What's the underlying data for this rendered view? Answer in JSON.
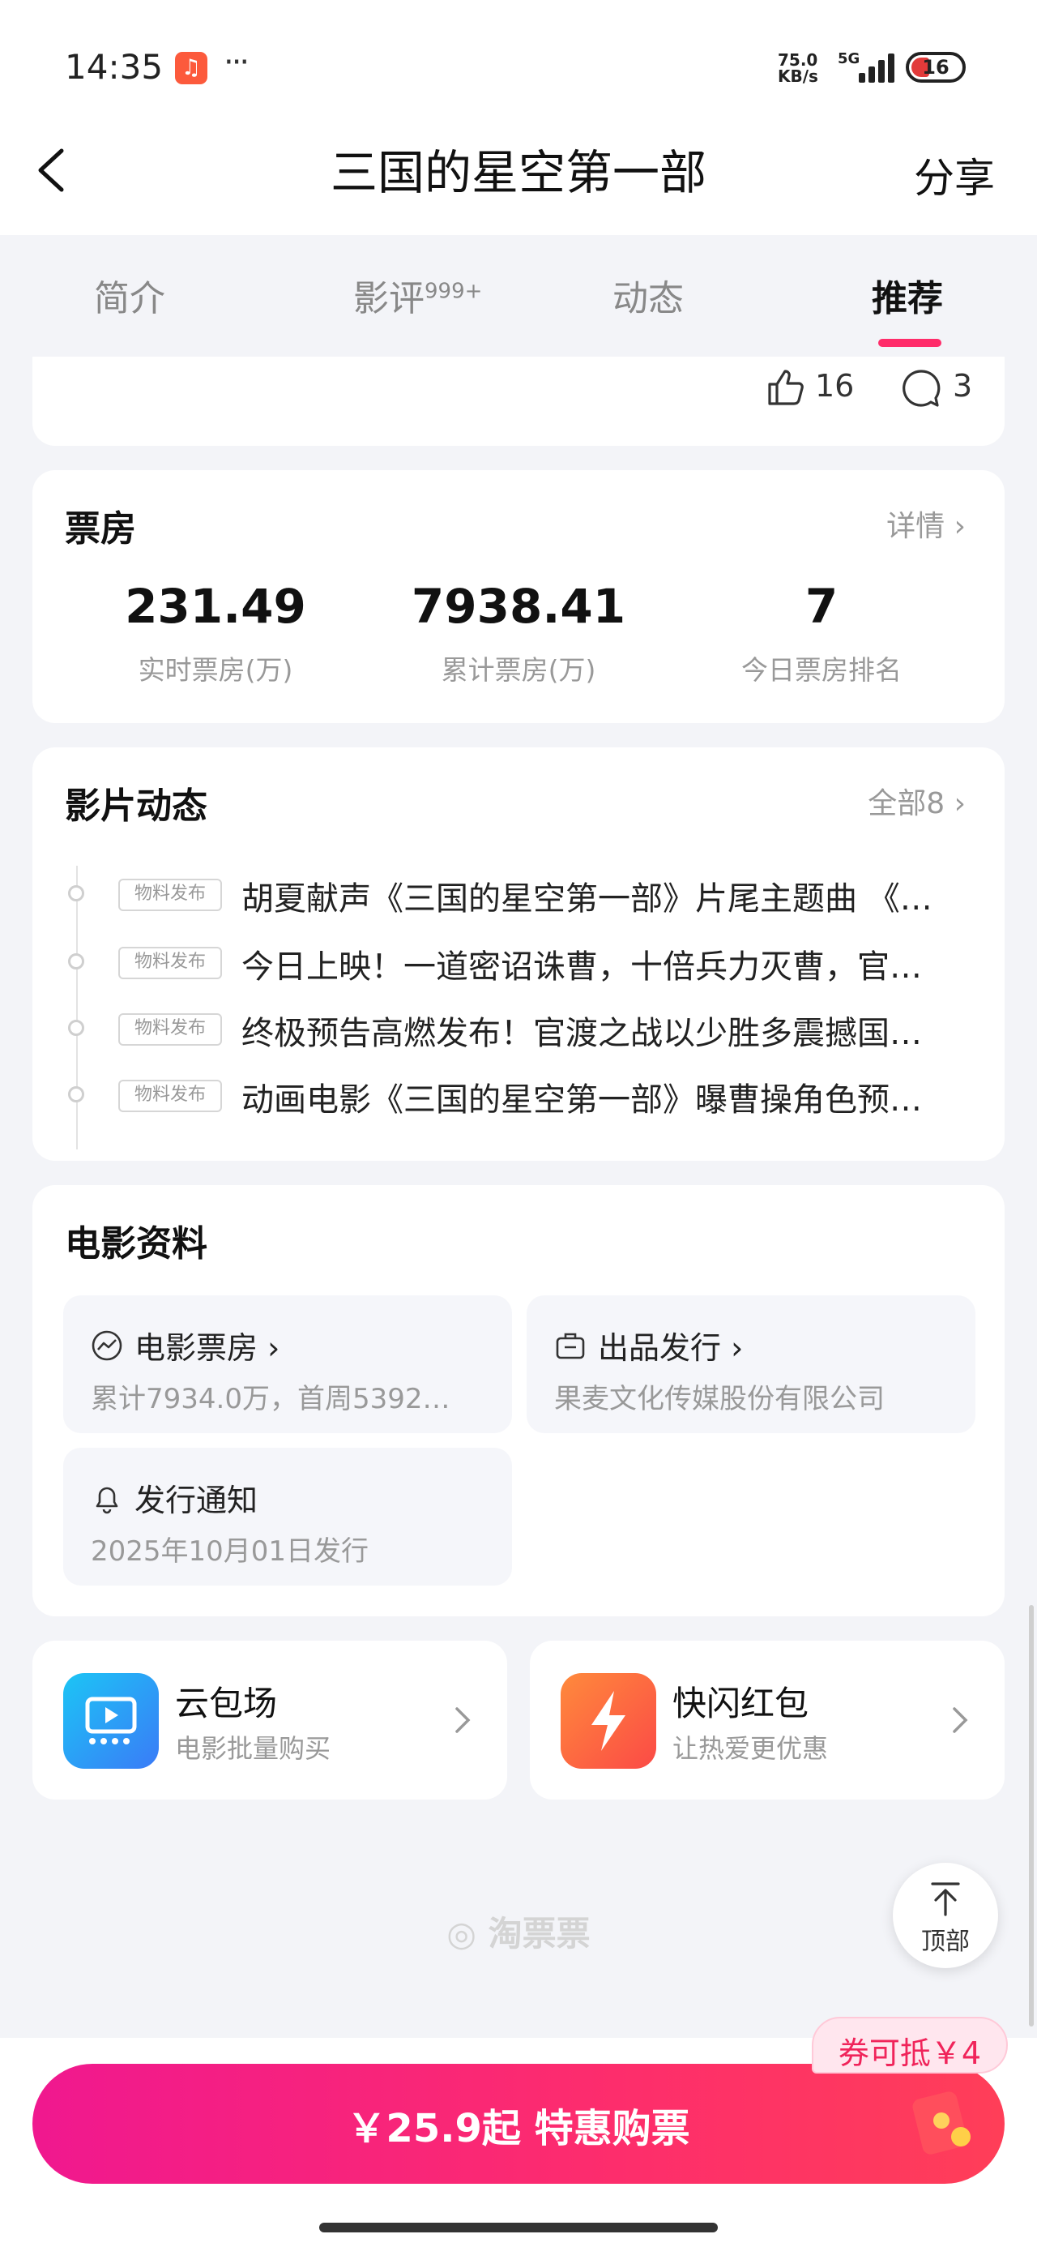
{
  "status_bar": {
    "time": "14:35",
    "speed_value": "75.0",
    "speed_unit": "KB/s",
    "network": "5G",
    "battery": "16"
  },
  "nav": {
    "title": "三国的星空第一部",
    "share_label": "分享"
  },
  "tabs": [
    {
      "label": "简介",
      "badge": ""
    },
    {
      "label": "影评",
      "badge": "999+"
    },
    {
      "label": "动态",
      "badge": ""
    },
    {
      "label": "推荐",
      "badge": ""
    }
  ],
  "active_tab": "推荐",
  "post_stats": {
    "likes": "16",
    "comments": "3"
  },
  "box_office": {
    "title": "票房",
    "link_label": "详情",
    "stats": [
      {
        "value": "231.49",
        "label": "实时票房(万)"
      },
      {
        "value": "7938.41",
        "label": "累计票房(万)"
      },
      {
        "value": "7",
        "label": "今日票房排名"
      }
    ]
  },
  "news": {
    "title": "影片动态",
    "link_label": "全部8",
    "items": [
      {
        "tag": "物料发布",
        "text": "胡夏献声《三国的星空第一部》片尾主题曲 《…"
      },
      {
        "tag": "物料发布",
        "text": "今日上映！一道密诏诛曹，十倍兵力灭曹，官…"
      },
      {
        "tag": "物料发布",
        "text": "终极预告高燃发布！官渡之战以少胜多震撼国…"
      },
      {
        "tag": "物料发布",
        "text": "动画电影《三国的星空第一部》曝曹操角色预…"
      }
    ]
  },
  "movie_info": {
    "title": "电影资料",
    "boxes": [
      {
        "title": "电影票房",
        "subtitle": "累计7934.0万，首周5392…",
        "icon": "chart-icon"
      },
      {
        "title": "出品发行",
        "subtitle": "果麦文化传媒股份有限公司",
        "icon": "briefcase-icon"
      },
      {
        "title": "发行通知",
        "subtitle": "2025年10月01日发行",
        "icon": "bell-icon"
      }
    ]
  },
  "promos": [
    {
      "title": "云包场",
      "subtitle": "电影批量购买",
      "icon": "cinema-screen-icon",
      "color": "#2f8cf5"
    },
    {
      "title": "快闪红包",
      "subtitle": "让热爱更优惠",
      "icon": "lightning-icon",
      "color": "#fb6a3c"
    }
  ],
  "footer_logo": "淘票票",
  "back_to_top_label": "顶部",
  "coupon_label": "券可抵￥4",
  "buy_button_label": "￥25.9起 特惠购票",
  "colors": {
    "accent": "#ff2c6a",
    "buy_gradient_start": "#f0188f",
    "buy_gradient_end": "#ff3e58"
  }
}
